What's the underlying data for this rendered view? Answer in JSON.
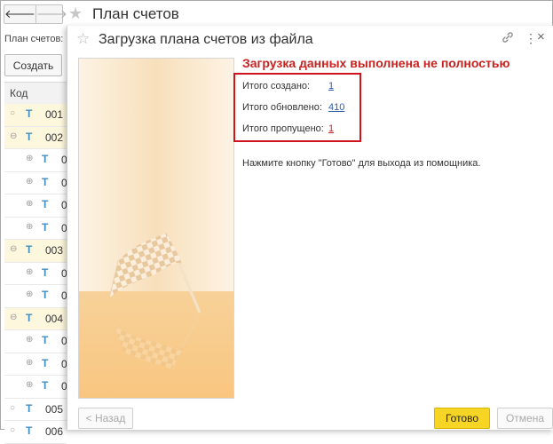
{
  "main_window": {
    "back_icon": "arrow-left-icon",
    "forward_icon": "arrow-right-icon",
    "favorite_icon": "star-icon",
    "title": "План счетов",
    "left_label": "План счетов:",
    "create_button": "Создать",
    "column_header": "Код",
    "rows": [
      {
        "code": "001",
        "expanded": false,
        "highlight": true,
        "level": 0
      },
      {
        "code": "002",
        "expanded": true,
        "highlight": true,
        "level": 0
      },
      {
        "code": "0",
        "highlight": false,
        "level": 1
      },
      {
        "code": "0",
        "highlight": false,
        "level": 1
      },
      {
        "code": "0",
        "highlight": false,
        "level": 1
      },
      {
        "code": "0",
        "highlight": false,
        "level": 1
      },
      {
        "code": "003",
        "expanded": true,
        "highlight": true,
        "level": 0
      },
      {
        "code": "0",
        "highlight": false,
        "level": 1
      },
      {
        "code": "0",
        "highlight": false,
        "level": 1
      },
      {
        "code": "004",
        "expanded": true,
        "highlight": true,
        "level": 0
      },
      {
        "code": "0",
        "highlight": false,
        "level": 1
      },
      {
        "code": "0",
        "highlight": false,
        "level": 1
      },
      {
        "code": "0",
        "highlight": false,
        "level": 1
      },
      {
        "code": "005",
        "expanded": false,
        "highlight": false,
        "level": 0
      },
      {
        "code": "006",
        "expanded": false,
        "highlight": false,
        "level": 0
      }
    ],
    "type_marker": "Т"
  },
  "dialog": {
    "title": "Загрузка плана счетов из файла",
    "status_title": "Загрузка данных выполнена не полностью",
    "stats": {
      "created_label": "Итого создано:",
      "created_value": "1",
      "updated_label": "Итого обновлено:",
      "updated_value": "410",
      "skipped_label": "Итого пропущено:",
      "skipped_value": "1"
    },
    "hint": "Нажмите кнопку \"Готово\" для выхода из помощника.",
    "back_button": "< Назад",
    "done_button": "Готово",
    "cancel_button": "Отмена"
  },
  "colors": {
    "accent_yellow": "#f7d524",
    "error_red": "#c8221f",
    "link_blue": "#2a5ba8",
    "highlight_row": "#fdf8dd"
  }
}
